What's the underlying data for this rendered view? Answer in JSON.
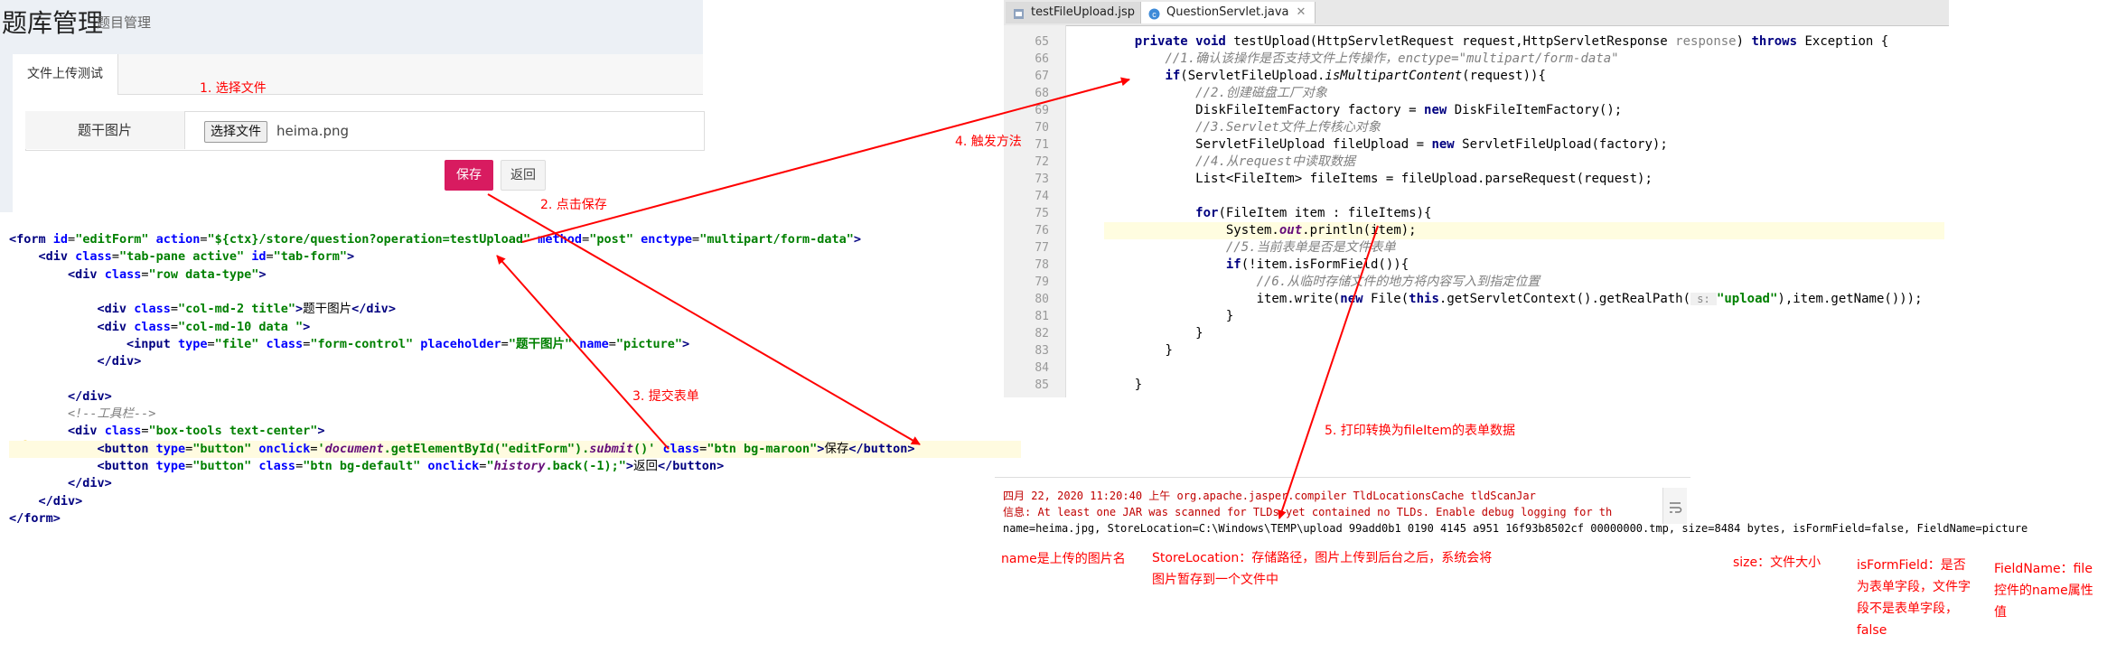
{
  "form": {
    "page_title": "题库管理",
    "page_subtitle": "题目管理",
    "tab_label": "文件上传测试",
    "field_label": "题干图片",
    "choose_button": "选择文件",
    "file_name": "heima.png",
    "save_button": "保存",
    "back_button": "返回"
  },
  "html_code": [
    "<form id=\"editForm\" action=\"${ctx}/store/question?operation=testUpload\" method=\"post\" enctype=\"multipart/form-data\">",
    "    <div class=\"tab-pane active\" id=\"tab-form\">",
    "        <div class=\"row data-type\">",
    "",
    "            <div class=\"col-md-2 title\">题干图片</div>",
    "            <div class=\"col-md-10 data \">",
    "                <input type=\"file\" class=\"form-control\" placeholder=\"题干图片\" name=\"picture\">",
    "            </div>",
    "",
    "        </div>",
    "        <!--工具栏-->",
    "        <div class=\"box-tools text-center\">",
    "            <button type=\"button\" onclick='document.getElementById(\"editForm\").submit()' class=\"btn bg-maroon\">保存</button>",
    "            <button type=\"button\" class=\"btn bg-default\" onclick=\"history.back(-1);\">返回</button>",
    "        </div>",
    "    </div>",
    "</form>"
  ],
  "ide": {
    "tabs": [
      {
        "label": "testFileUpload.jsp",
        "icon": "jsp-file-icon"
      },
      {
        "label": "QuestionServlet.java",
        "icon": "java-class-icon"
      }
    ],
    "line_numbers": [
      "65",
      "66",
      "67",
      "68",
      "69",
      "70",
      "71",
      "72",
      "73",
      "74",
      "75",
      "76",
      "77",
      "78",
      "79",
      "80",
      "81",
      "82",
      "83",
      "84",
      "85"
    ],
    "code": {
      "l65_a": "private void ",
      "l65_b": "testUpload(HttpServletRequest request,HttpServletResponse ",
      "l65_c": "response",
      "l65_d": ") ",
      "l65_e": "throws ",
      "l65_f": "Exception {",
      "l66_a": "//1.确认该操作是否支持文件上传操作，",
      "l66_b": "enctype=\"multipart/form-data\"",
      "l67_a": "if",
      "l67_b": "(ServletFileUpload.",
      "l67_c": "isMultipartContent",
      "l67_d": "(request)){",
      "l68": "//2.创建磁盘工厂对象",
      "l69_a": "DiskFileItemFactory factory = ",
      "l69_b": "new ",
      "l69_c": "DiskFileItemFactory();",
      "l70_a": "//3.",
      "l70_b": "Servlet",
      "l70_c": "文件上传核心对象",
      "l71_a": "ServletFileUpload fileUpload = ",
      "l71_b": "new ",
      "l71_c": "ServletFileUpload(factory);",
      "l72_a": "//4.从",
      "l72_b": "request",
      "l72_c": "中读取数据",
      "l73": "List<FileItem> fileItems = fileUpload.parseRequest(request);",
      "l75_a": "for",
      "l75_b": "(FileItem item : fileItems){",
      "l76_a": "System.",
      "l76_b": "out",
      "l76_c": ".println(item);",
      "l77": "//5.当前表单是否是文件表单",
      "l78_a": "if",
      "l78_b": "(!item.isFormField()){",
      "l79": "//6.从临时存储文件的地方将内容写入到指定位置",
      "l80_a": "item.write(",
      "l80_b": "new ",
      "l80_c": "File(",
      "l80_d": "this",
      "l80_e": ".getServletContext().getRealPath(",
      "l80_f": " s: ",
      "l80_g": "\"upload\"",
      "l80_h": "),item.getName()));",
      "close_brace": "}"
    }
  },
  "console": {
    "line1": "四月 22, 2020 11:20:40 上午 org.apache.jasper.compiler TldLocationsCache tldScanJar",
    "line2": "信息: At least one JAR was scanned for TLDs yet contained no TLDs. Enable debug logging for th",
    "line3": "name=heima.jpg, StoreLocation=C:\\Windows\\TEMP\\upload 99add0b1 0190 4145 a951 16f93b8502cf 00000000.tmp, size=8484 bytes, isFormField=false, FieldName=picture"
  },
  "annotations": {
    "step1": "1. 选择文件",
    "step2": "2. 点击保存",
    "step3": "3. 提交表单",
    "step4": "4. 触发方法",
    "step5": "5. 打印转换为fileItem的表单数据",
    "name_note": "name是上传的图片名",
    "store_note_1": "StoreLocation：存储路径，图片上传到后台之后，系统会将",
    "store_note_2": "图片暂存到一个文件中",
    "size_note": "size：文件大小",
    "formfield_note_1": "isFormField：是否",
    "formfield_note_2": "为表单字段，文件字",
    "formfield_note_3": "段不是表单字段，",
    "formfield_note_4": "false",
    "fieldname_note_1": "FieldName：file",
    "fieldname_note_2": "控件的name属性",
    "fieldname_note_3": "值"
  },
  "colors": {
    "annotation": "#ff0000",
    "save_button": "#d81b60",
    "tab_accent": "#3c8dbc"
  }
}
